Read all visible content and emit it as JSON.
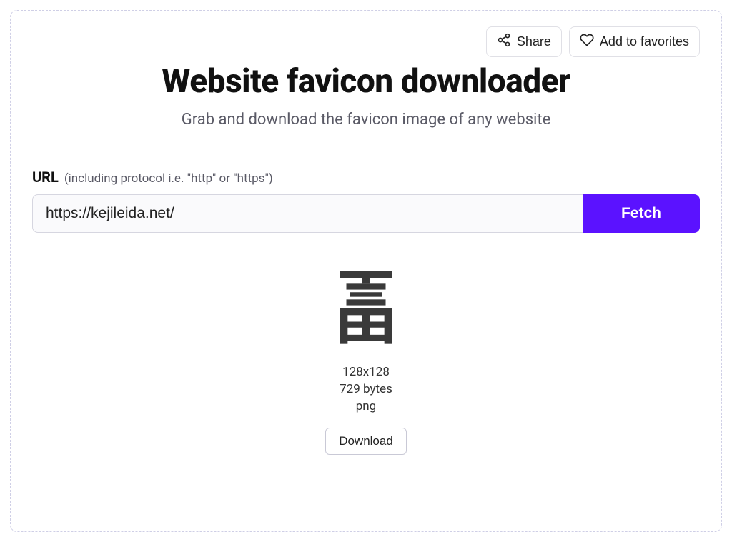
{
  "actions": {
    "share": "Share",
    "favorite": "Add to favorites"
  },
  "hero": {
    "title": "Website favicon downloader",
    "subtitle": "Grab and download the favicon image of any website"
  },
  "form": {
    "label": "URL",
    "hint": "(including protocol i.e. \"http\" or \"https\")",
    "value": "https://kejileida.net/",
    "button": "Fetch"
  },
  "result": {
    "dimensions": "128x128",
    "size": "729 bytes",
    "format": "png",
    "download": "Download"
  }
}
